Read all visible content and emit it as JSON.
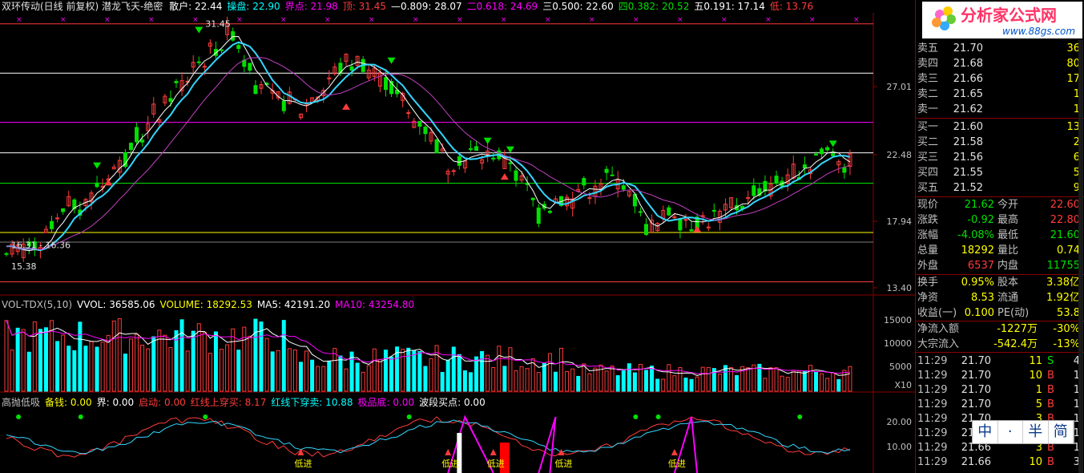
{
  "main_header": {
    "title": "双环传动(日线 前复权) 潜龙飞天-绝密",
    "items": [
      {
        "label": "散户: 22.44",
        "color": "#ffffff"
      },
      {
        "label": "操盘: 22.90",
        "color": "#00ffff"
      },
      {
        "label": "界点: 21.98",
        "color": "#ff00ff"
      },
      {
        "label": "顶: 31.45",
        "color": "#ff3b3b"
      },
      {
        "label": "—0.809: 28.07",
        "color": "#ffffff"
      },
      {
        "label": "二0.618: 24.69",
        "color": "#ff00ff"
      },
      {
        "label": "三0.500: 22.60",
        "color": "#ffffff"
      },
      {
        "label": "四0.382: 20.52",
        "color": "#00e000"
      },
      {
        "label": "五0.191: 17.14",
        "color": "#ffffff"
      },
      {
        "label": "低: 13.76",
        "color": "#ff3b3b"
      }
    ]
  },
  "price_annotations": {
    "high": "31.45",
    "low_range": "16.31 - 16.36",
    "low": "15.38"
  },
  "price_axis": [
    "27.01",
    "22.48",
    "17.94",
    "13.40"
  ],
  "vol_header": {
    "items": [
      {
        "label": "VOL-TDX(5,10)",
        "color": "#c0c0c0"
      },
      {
        "label": "VVOL: 36585.06",
        "color": "#ffffff"
      },
      {
        "label": "VOLUME: 18292.53",
        "color": "#ffff00"
      },
      {
        "label": "MA5: 42191.20",
        "color": "#ffffff"
      },
      {
        "label": "MA10: 43254.80",
        "color": "#ff00ff"
      }
    ]
  },
  "vol_axis": [
    "15000",
    "10000",
    "5000",
    "X10"
  ],
  "ind_header": {
    "items": [
      {
        "label": "高抛低吸",
        "color": "#c0c0c0"
      },
      {
        "label": "备钱: 0.00",
        "color": "#ffff00"
      },
      {
        "label": "界: 0.00",
        "color": "#ffffff"
      },
      {
        "label": "启动: 0.00",
        "color": "#ff3b3b"
      },
      {
        "label": "红线上穿买: 8.17",
        "color": "#ff3b3b"
      },
      {
        "label": "红线下穿卖: 10.88",
        "color": "#00ffff"
      },
      {
        "label": "极品底: 0.00",
        "color": "#ff00ff"
      },
      {
        "label": "波段买点: 0.00",
        "color": "#ffffff"
      }
    ]
  },
  "ind_axis": [
    "20.00",
    "10.00"
  ],
  "ind_markers": {
    "buy_label": "低进"
  },
  "order_book": {
    "sell": [
      {
        "label": "卖五",
        "price": "21.70",
        "vol": "36"
      },
      {
        "label": "卖四",
        "price": "21.68",
        "vol": "80"
      },
      {
        "label": "卖三",
        "price": "21.66",
        "vol": "17"
      },
      {
        "label": "卖二",
        "price": "21.65",
        "vol": "1"
      },
      {
        "label": "卖一",
        "price": "21.62",
        "vol": "1"
      }
    ],
    "buy": [
      {
        "label": "买一",
        "price": "21.60",
        "vol": "13"
      },
      {
        "label": "买二",
        "price": "21.58",
        "vol": "2"
      },
      {
        "label": "买三",
        "price": "21.56",
        "vol": "6"
      },
      {
        "label": "买四",
        "price": "21.55",
        "vol": "5"
      },
      {
        "label": "买五",
        "price": "21.52",
        "vol": "9"
      }
    ]
  },
  "quote": [
    {
      "l1": "现价",
      "v1": "21.62",
      "c1": "#00e000",
      "l2": "今开",
      "v2": "22.60",
      "c2": "#ff3b3b"
    },
    {
      "l1": "涨跌",
      "v1": "-0.92",
      "c1": "#00e000",
      "l2": "最高",
      "v2": "22.80",
      "c2": "#ff3b3b"
    },
    {
      "l1": "涨幅",
      "v1": "-4.08%",
      "c1": "#00e000",
      "l2": "最低",
      "v2": "21.60",
      "c2": "#00e000"
    },
    {
      "l1": "总量",
      "v1": "18292",
      "c1": "#ffff00",
      "l2": "量比",
      "v2": "0.74",
      "c2": "#ffff00"
    },
    {
      "l1": "外盘",
      "v1": "6537",
      "c1": "#ff3b3b",
      "l2": "内盘",
      "v2": "11755",
      "c2": "#00e000"
    }
  ],
  "fundamentals": [
    {
      "l1": "换手",
      "v1": "0.95%",
      "l2": "股本",
      "v2": "3.38亿"
    },
    {
      "l1": "净资",
      "v1": "8.53",
      "l2": "流通",
      "v2": "1.92亿"
    },
    {
      "l1": "收益(一)",
      "v1": "0.100",
      "l2": "PE(动)",
      "v2": "53.8"
    }
  ],
  "flows": [
    {
      "label": "净流入额",
      "value": "-1227万",
      "pct": "-30%"
    },
    {
      "label": "大宗流入",
      "value": "-542.4万",
      "pct": "-13%"
    }
  ],
  "ticks": [
    {
      "time": "11:29",
      "price": "21.70",
      "vol": "11",
      "side": "S",
      "n": "4"
    },
    {
      "time": "11:29",
      "price": "21.70",
      "vol": "10",
      "side": "B",
      "n": "1"
    },
    {
      "time": "11:29",
      "price": "21.70",
      "vol": "1",
      "side": "B",
      "n": "1"
    },
    {
      "time": "11:29",
      "price": "21.70",
      "vol": "5",
      "side": "B",
      "n": "1"
    },
    {
      "time": "11:29",
      "price": "21.70",
      "vol": "3",
      "side": "B",
      "n": "1"
    },
    {
      "time": "11:29",
      "price": "21.70",
      "vol": "2",
      "side": "B",
      "n": "1"
    },
    {
      "time": "11:29",
      "price": "21.66",
      "vol": "3",
      "side": "B",
      "n": "1"
    },
    {
      "time": "11:29",
      "price": "21.66",
      "vol": "10",
      "side": "B",
      "n": "3"
    }
  ],
  "logo": {
    "title": "分析家公式网",
    "url": "www.88gs.com"
  },
  "scale_buttons": [
    "中",
    "·",
    "半",
    "简"
  ],
  "colors": {
    "up": "#ff3b3b",
    "down": "#00ffff",
    "down_vol": "#00ffff",
    "ma_white": "#ffffff",
    "ma_cyan": "#33d6ff",
    "ma_purple": "#c040c0",
    "frame": "#8b0000"
  }
}
